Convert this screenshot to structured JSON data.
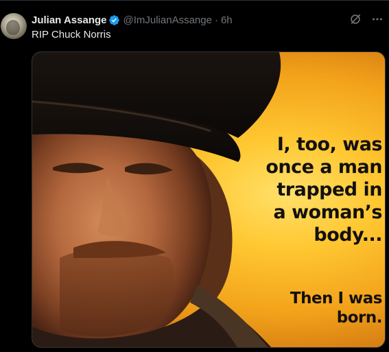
{
  "tweet": {
    "display_name": "Julian Assange",
    "handle": "@ImJulianAssange",
    "separator": "·",
    "time": "6h",
    "text": "RIP Chuck Norris",
    "verified": true,
    "verified_color": "#1d9bf0"
  },
  "actions": {
    "grok_icon": "slashed-circle-icon",
    "more_icon": "more-dots-icon",
    "more_label": "···"
  },
  "media": {
    "quote_main": "I, too, was\nonce a man\ntrapped in\na woman’s\nbody...",
    "quote_end": "Then I was\nborn."
  }
}
